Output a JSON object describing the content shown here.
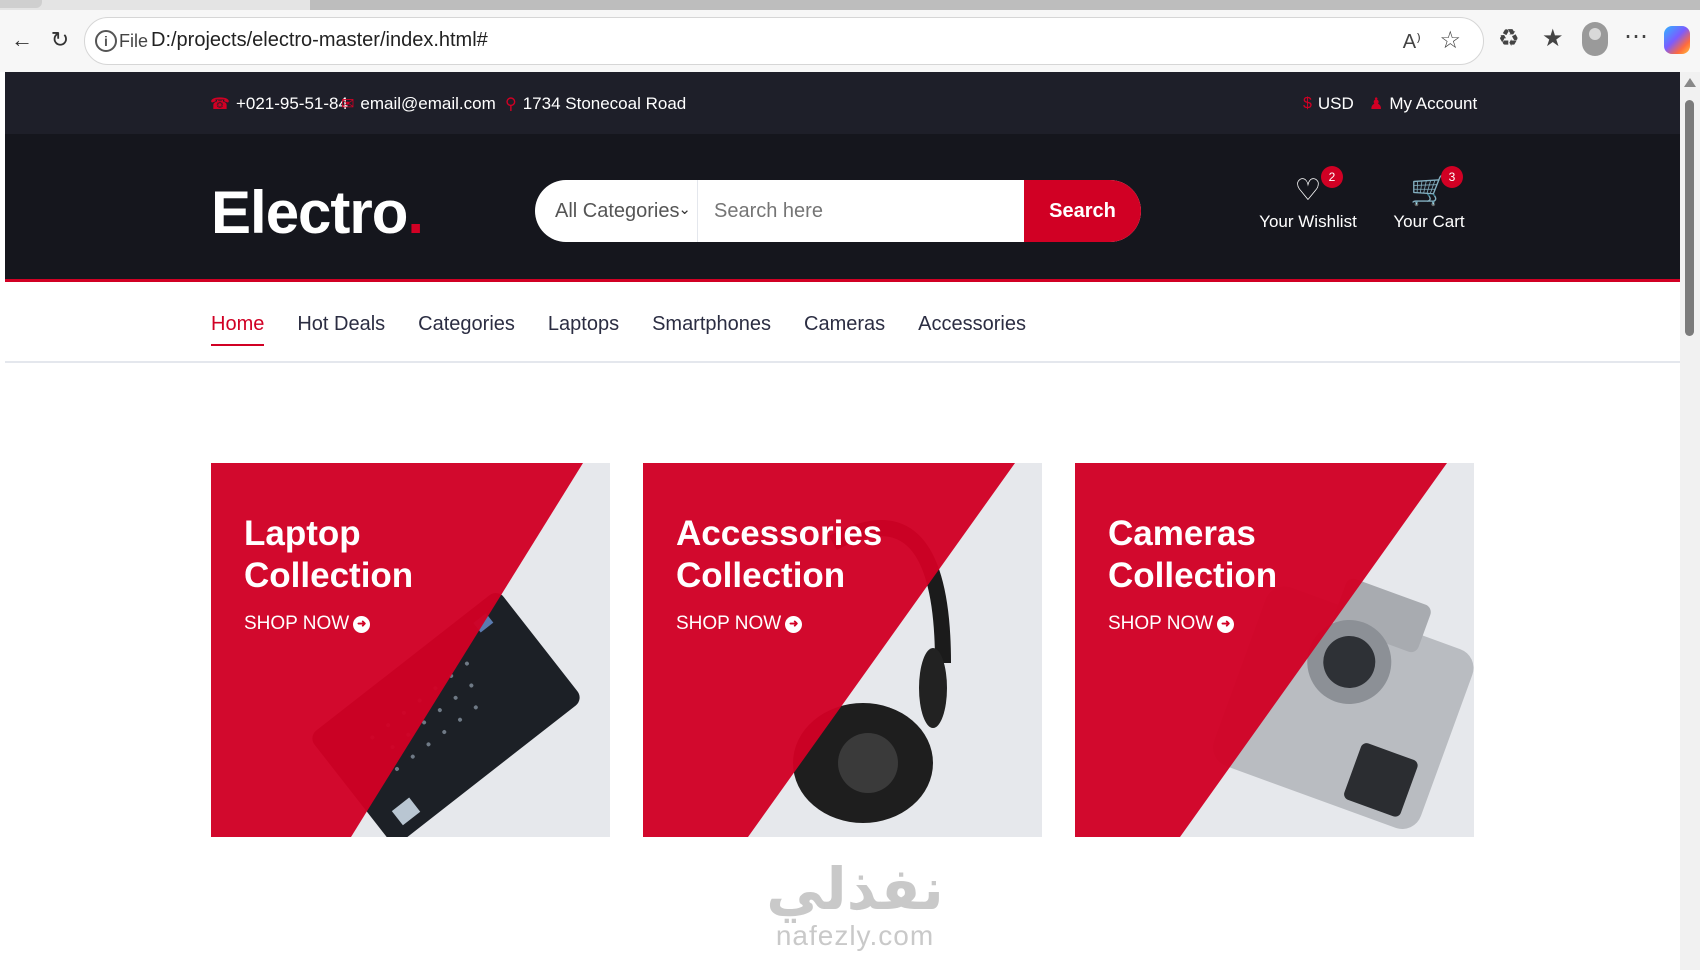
{
  "browser": {
    "file_label": "File",
    "url": "D:/projects/electro-master/index.html#",
    "read_aloud": "A⁾"
  },
  "topbar": {
    "phone": "+021-95-51-84",
    "email": "email@email.com",
    "address": "1734 Stonecoal Road",
    "currency": "USD",
    "account": "My Account"
  },
  "header": {
    "logo": "Electro",
    "logo_dot": ".",
    "category_select": "All Categories",
    "search_placeholder": "Search here",
    "search_button": "Search",
    "wishlist": {
      "label": "Your Wishlist",
      "count": "2"
    },
    "cart": {
      "label": "Your Cart",
      "count": "3"
    }
  },
  "nav": {
    "items": [
      "Home",
      "Hot Deals",
      "Categories",
      "Laptops",
      "Smartphones",
      "Cameras",
      "Accessories"
    ],
    "active": "Home"
  },
  "collections": [
    {
      "title": "Laptop Collection",
      "cta": "SHOP NOW"
    },
    {
      "title": "Accessories Collection",
      "cta": "SHOP NOW"
    },
    {
      "title": "Cameras Collection",
      "cta": "SHOP NOW"
    }
  ],
  "watermark": {
    "arabic": "نفذلي",
    "latin": "nafezly.com"
  },
  "colors": {
    "primary": "#D10024",
    "dark": "#15161D",
    "topbar": "#1E1F29"
  }
}
